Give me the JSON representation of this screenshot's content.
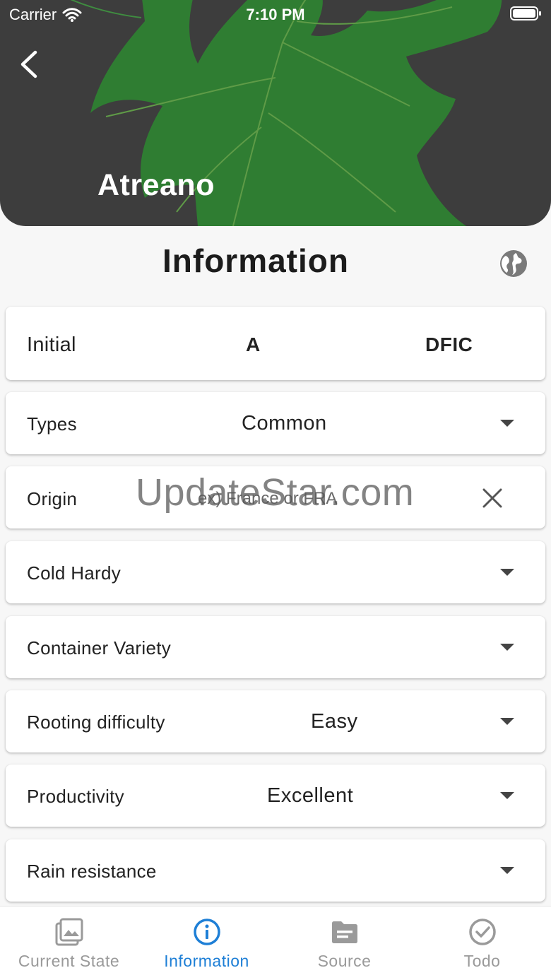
{
  "status_bar": {
    "carrier": "Carrier",
    "time": "7:10 PM"
  },
  "header": {
    "title": "Atreano",
    "background_color": "#3d3d3d",
    "leaf_color": "#2e7d32"
  },
  "section": {
    "title": "Information"
  },
  "initial": {
    "label": "Initial",
    "letter": "A",
    "code": "DFIC"
  },
  "fields": {
    "types": {
      "label": "Types",
      "value": "Common"
    },
    "origin": {
      "label": "Origin",
      "placeholder": "ex) France or FRA"
    },
    "cold_hardy": {
      "label": "Cold Hardy",
      "value": ""
    },
    "container_variety": {
      "label": "Container Variety",
      "value": ""
    },
    "rooting_difficulty": {
      "label": "Rooting difficulty",
      "value": "Easy"
    },
    "productivity": {
      "label": "Productivity",
      "value": "Excellent"
    },
    "rain_resistance": {
      "label": "Rain resistance",
      "value": ""
    }
  },
  "watermark": "UpdateStar.com",
  "bottom_nav": {
    "items": [
      {
        "label": "Current State",
        "icon": "image-icon",
        "active": false
      },
      {
        "label": "Information",
        "icon": "info-icon",
        "active": true
      },
      {
        "label": "Source",
        "icon": "folder-icon",
        "active": false
      },
      {
        "label": "Todo",
        "icon": "check-circle-icon",
        "active": false
      }
    ],
    "active_color": "#1e7fd6",
    "inactive_color": "#9a9a9a"
  }
}
